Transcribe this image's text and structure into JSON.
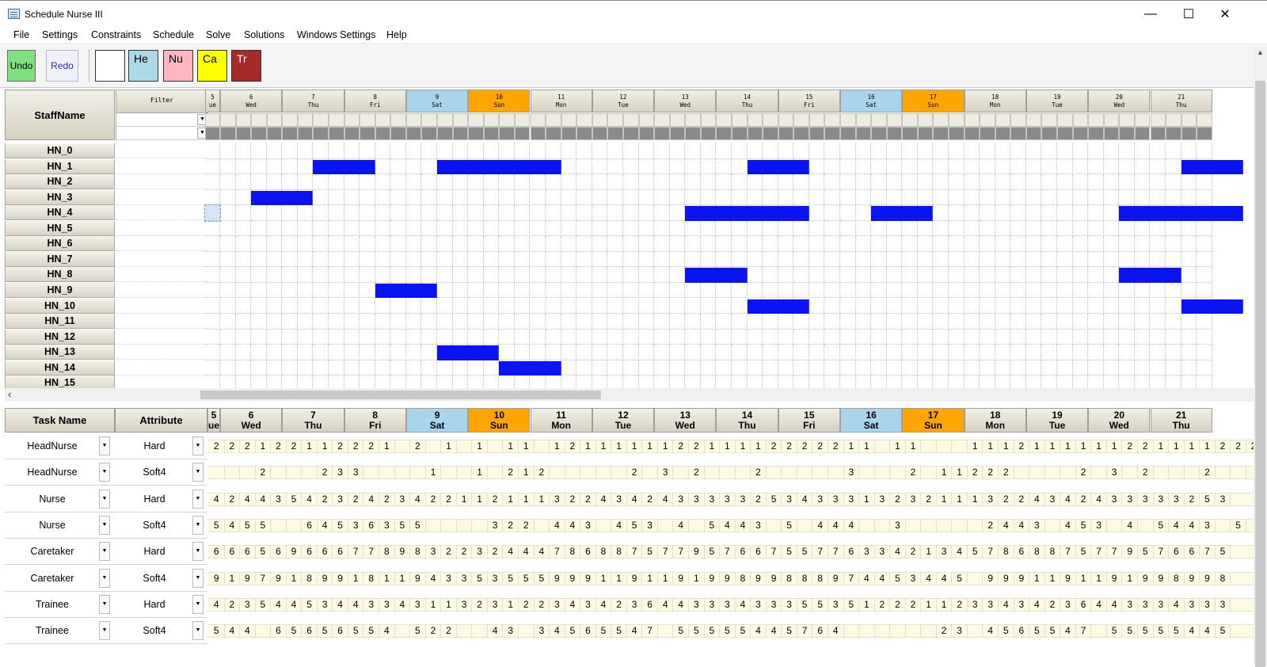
{
  "window": {
    "title": "Schedule Nurse III",
    "minimize": "—",
    "maximize": "☐",
    "close": "✕"
  },
  "menu": [
    "File",
    "Settings",
    "Constraints",
    "Schedule",
    "Solve",
    "Solutions",
    "Windows Settings",
    "Help"
  ],
  "toolbar": {
    "undo": "Undo",
    "redo": "Redo",
    "swatches": [
      {
        "label": "",
        "color": "#ffffff"
      },
      {
        "label": "He",
        "color": "#add8e6"
      },
      {
        "label": "Nu",
        "color": "#ffb6c1"
      },
      {
        "label": "Ca",
        "color": "#ffff00"
      },
      {
        "label": "Tr",
        "color": "#a52a2a"
      }
    ]
  },
  "colors": {
    "saturday": "#a8d4ec",
    "sunday": "#ffa500",
    "assignment": "#0a14f0"
  },
  "upper": {
    "staff_header": "StaffName",
    "filter_label": "Filter",
    "partial_day": {
      "num": "5",
      "name": "ue"
    },
    "days": [
      {
        "num": "6",
        "name": "Wed"
      },
      {
        "num": "7",
        "name": "Thu"
      },
      {
        "num": "8",
        "name": "Fri"
      },
      {
        "num": "9",
        "name": "Sat",
        "type": "sat"
      },
      {
        "num": "10",
        "name": "Sun",
        "type": "sun"
      },
      {
        "num": "11",
        "name": "Mon"
      },
      {
        "num": "12",
        "name": "Tue"
      },
      {
        "num": "13",
        "name": "Wed"
      },
      {
        "num": "14",
        "name": "Thu"
      },
      {
        "num": "15",
        "name": "Fri"
      },
      {
        "num": "16",
        "name": "Sat",
        "type": "sat"
      },
      {
        "num": "17",
        "name": "Sun",
        "type": "sun"
      },
      {
        "num": "18",
        "name": "Mon"
      },
      {
        "num": "19",
        "name": "Tue"
      },
      {
        "num": "20",
        "name": "Wed"
      },
      {
        "num": "21",
        "name": "Thu"
      }
    ],
    "staff": [
      "HN_0",
      "HN_1",
      "HN_2",
      "HN_3",
      "HN_4",
      "HN_5",
      "HN_6",
      "HN_7",
      "HN_8",
      "HN_9",
      "HN_10",
      "HN_11",
      "HN_12",
      "HN_13",
      "HN_14",
      "HN_15"
    ],
    "assignments": [
      {
        "row": 1,
        "start": 6,
        "len": 4
      },
      {
        "row": 1,
        "start": 14,
        "len": 8
      },
      {
        "row": 1,
        "start": 34,
        "len": 4
      },
      {
        "row": 1,
        "start": 62,
        "len": 4
      },
      {
        "row": 3,
        "start": 2,
        "len": 4
      },
      {
        "row": 4,
        "start": 30,
        "len": 8
      },
      {
        "row": 4,
        "start": 42,
        "len": 4
      },
      {
        "row": 4,
        "start": 58,
        "len": 8
      },
      {
        "row": 8,
        "start": 30,
        "len": 4
      },
      {
        "row": 8,
        "start": 58,
        "len": 4
      },
      {
        "row": 9,
        "start": 10,
        "len": 4
      },
      {
        "row": 10,
        "start": 34,
        "len": 4
      },
      {
        "row": 10,
        "start": 62,
        "len": 4
      },
      {
        "row": 13,
        "start": 14,
        "len": 4
      },
      {
        "row": 14,
        "start": 18,
        "len": 4
      }
    ]
  },
  "lower": {
    "task_header": "Task Name",
    "attribute_header": "Attribute",
    "partial_day": {
      "num": "5",
      "name": "ue"
    },
    "tasks": [
      {
        "name": "HeadNurse",
        "attribute": "Hard",
        "values": "2 2 2 1 2 2 1 1 2 2 2 1 _ 2 _ 1 _ 1 _ 1 1 _ 1 2 1 1 1 1 1 1 2 2 1 1 1 1 2 2 2 2 2 1 1 _ 1 1 _ _ _ 1 1 1 2 1 1 1 1 1 1 2 2 1 1 1 1 2 2 2"
      },
      {
        "name": "HeadNurse",
        "attribute": "Soft4",
        "values": "_ _ _ 2 _ _ _ 2 3 3 _ _ _ _ 1 _ _ 1 _ 2 1 2 _ _ _ _ _ 2 _ 3 _ 2 _ _ _ 2 _ _ _ _ _ 3 _ _ _ 2 _ 1 1 2 2 2 _ _ _ _ 2 _ 3 _ 2 _ _ _ 2 _ _"
      },
      {
        "name": "Nurse",
        "attribute": "Hard",
        "values": "4 2 4 4 3 5 4 2 3 2 4 2 3 4 2 2 1 1 2 1 1 1 3 2 2 4 3 4 2 4 3 3 3 3 3 2 5 3 4 3 3 3 1 3 2 3 2 1 1 1 3 2 2 4 3 4 2 4 3 3 3 3 3 2 5 3"
      },
      {
        "name": "Nurse",
        "attribute": "Soft4",
        "values": "5 4 5 5 _ _ 6 4 5 3 6 3 5 5 _ _ _ _ 3 2 2 _ 4 4 3 _ 4 5 3 _ 4 _ 5 4 4 3 _ 5 _ 4 4 4 _ _ 3 _ _ _ _ _ 2 4 4 3 _ 4 5 3 _ 4 _ 5 4 4 3 _ 5"
      },
      {
        "name": "Caretaker",
        "attribute": "Hard",
        "values": "6 6 6 5 6 9 6 6 6 7 7 8 9 8 3 2 2 3 2 4 4 4 7 8 6 8 8 7 5 7 7 9 5 7 6 6 7 5 5 7 7 6 3 3 4 2 1 3 4 5 7 8 6 8 8 7 5 7 7 9 5 7 6 6 7 5"
      },
      {
        "name": "Caretaker",
        "attribute": "Soft4",
        "values": "9 1 9 7 9 1 8 9 9 1 8 1 1 9 4 3 3 5 3 5 5 5 9 9 9 1 1 9 1 1 9 1 9 9 8 9 9 8 8 8 9 7 4 4 5 3 4 4 5 _ 9 9 9 1 1 9 1 1 9 1 9 9 8 9 9 8"
      },
      {
        "name": "Trainee",
        "attribute": "Hard",
        "values": "4 2 3 5 4 4 5 3 4 4 3 3 4 3 1 1 3 2 3 1 2 2 3 4 3 4 2 3 6 4 4 3 3 3 4 3 3 3 5 5 3 5 1 2 2 2 1 1 2 3 3 4 3 4 2 3 6 4 4 3 3 3 4 3 3 3"
      },
      {
        "name": "Trainee",
        "attribute": "Soft4",
        "values": "5 4 4 _ 6 5 6 5 6 5 5 4 _ 5 2 2 _ _ 4 3 _ 3 4 5 6 5 5 4 7 _ 5 5 5 5 5 4 4 5 7 6 4 _ _ _ _ _ _ 2 3 _ 4 5 6 5 5 4 7 _ 5 5 5 5 5 4 4 5"
      }
    ]
  }
}
